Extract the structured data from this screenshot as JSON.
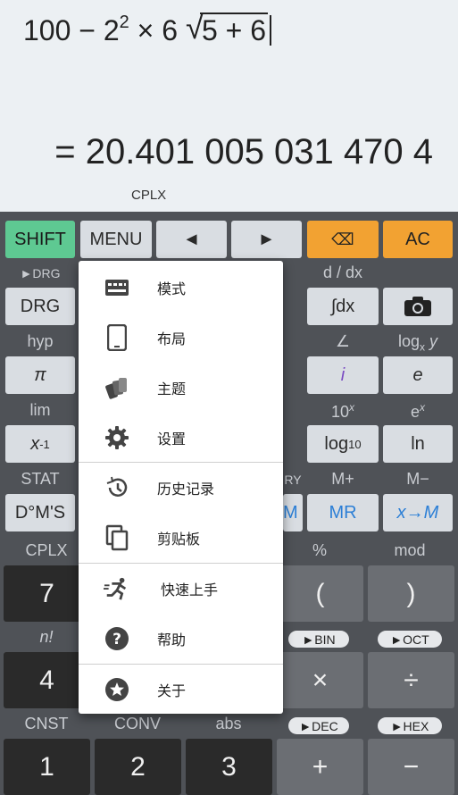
{
  "display": {
    "expr_base": "100 − 2",
    "expr_exp": "2",
    "expr_mid": " × 6 ",
    "sqrt_sign": "√",
    "radicand": "5 + 6",
    "result": "= 20.401 005 031 470 4",
    "mode": "CPLX"
  },
  "top_keys": {
    "shift": "SHIFT",
    "menu": "MENU",
    "left": "◄",
    "right": "►",
    "backspace": "⌫",
    "ac": "AC"
  },
  "labels": {
    "drg_shift": "►DRG",
    "ddx": "d / dx",
    "hyp": "hyp",
    "angle": "∠",
    "logxy": "log",
    "logxy_sub": "x",
    "logxy_tail": " y",
    "lim": "lim",
    "ten_x": "10",
    "ten_x_sup": "x",
    "e_x": "e",
    "e_x_sup": "x",
    "stat": "STAT",
    "ry": "RY",
    "m_plus": "M+",
    "m_minus": "M−",
    "cplx": "CPLX",
    "percent": "%",
    "mod": "mod",
    "nfact": "n!",
    "cnst": "CNST",
    "conv": "CONV",
    "abs": "abs"
  },
  "keys": {
    "drg": "DRG",
    "integral": "∫dx",
    "pi": "π",
    "imag": "i",
    "e": "e",
    "xinv": "x",
    "xinv_sup": "-1",
    "log10": "log",
    "log10_sub": "10",
    "ln": "ln",
    "dms": "D°M'S",
    "m_partial": "M",
    "mr": "MR",
    "x_to_m": "x→M",
    "seven": "7",
    "lparen": "(",
    "rparen": ")",
    "four": "4",
    "times": "×",
    "divide": "÷",
    "one": "1",
    "two": "2",
    "three": "3",
    "plus": "+",
    "minus": "−",
    "bin": "►BIN",
    "oct": "►OCT",
    "dec": "►DEC",
    "hex": "►HEX"
  },
  "menu": {
    "items": [
      {
        "label": "模式",
        "icon": "keyboard-icon"
      },
      {
        "label": "布局",
        "icon": "tablet-icon"
      },
      {
        "label": "主题",
        "icon": "palette-icon"
      },
      {
        "label": "设置",
        "icon": "gear-icon"
      },
      {
        "label": "历史记录",
        "icon": "history-icon"
      },
      {
        "label": "剪贴板",
        "icon": "clipboard-icon"
      },
      {
        "label": "快速上手",
        "icon": "running-icon"
      },
      {
        "label": "帮助",
        "icon": "help-icon"
      },
      {
        "label": "关于",
        "icon": "star-icon"
      }
    ]
  },
  "colors": {
    "shift": "#5ec992",
    "orange": "#f2a232",
    "memory_blue": "#2c7fd6"
  }
}
